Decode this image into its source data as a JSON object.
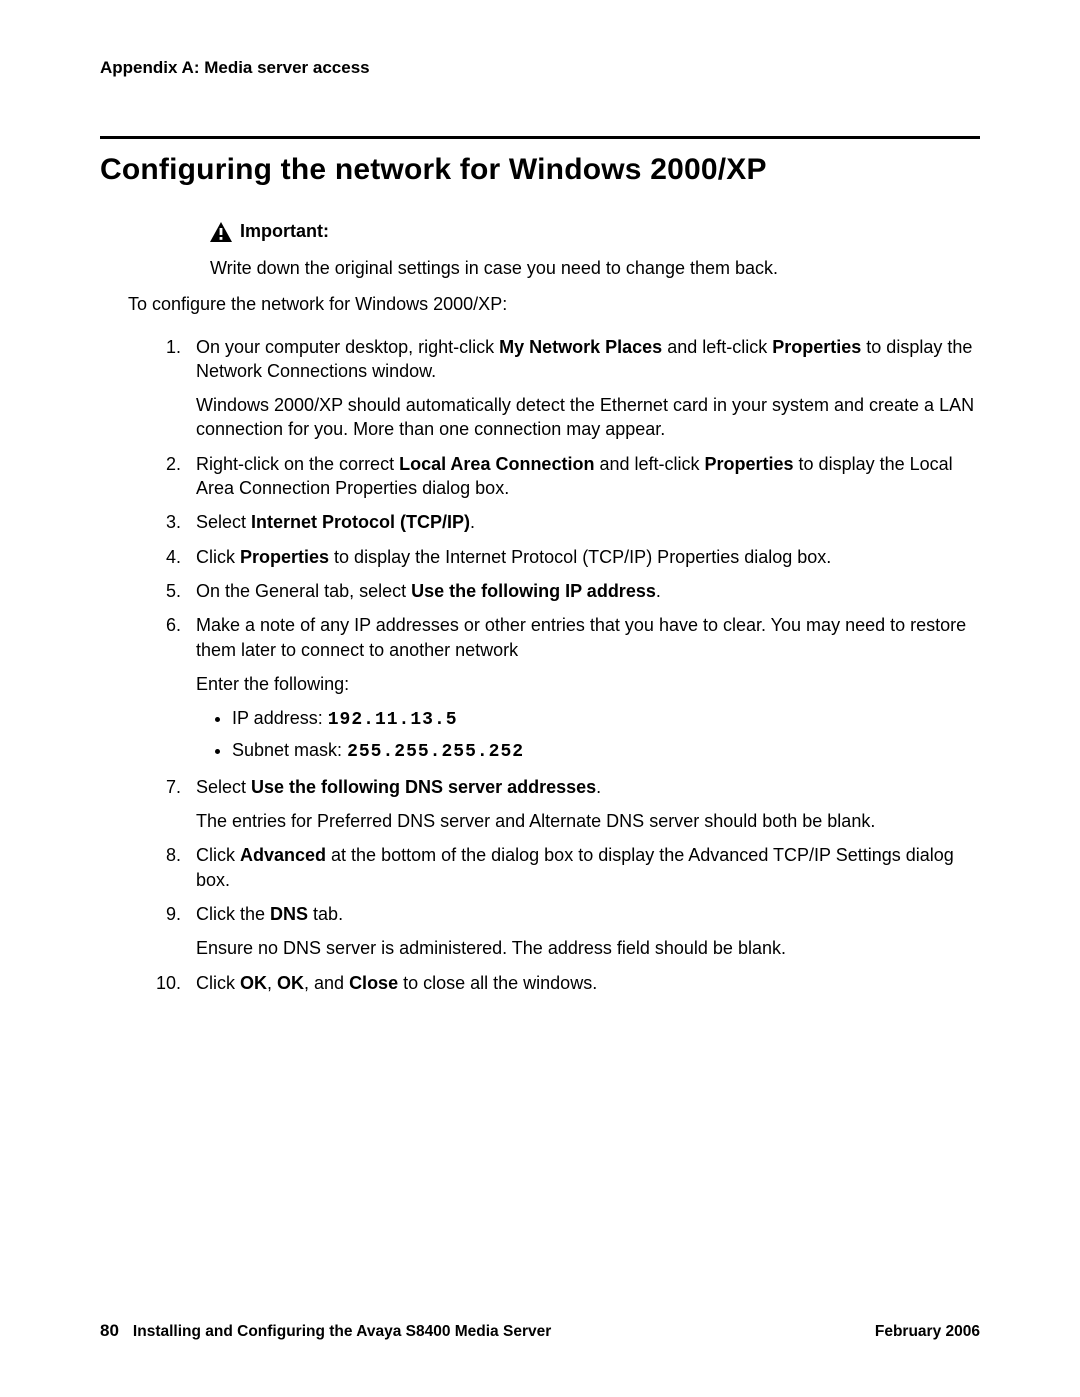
{
  "header": "Appendix A: Media server access",
  "title": "Configuring the network for Windows 2000/XP",
  "callout": {
    "label": "Important:",
    "text": "Write down the original settings in case you need to change them back."
  },
  "intro": "To configure the network for Windows 2000/XP:",
  "steps": {
    "s1": {
      "pre1": "On your computer desktop, right-click ",
      "b1": "My Network Places",
      "mid1": " and left-click ",
      "b2": "Properties",
      "post1": " to display the Network Connections window.",
      "p2": "Windows 2000/XP should automatically detect the Ethernet card in your system and create a LAN connection for you. More than one connection may appear."
    },
    "s2": {
      "pre1": "Right-click on the correct ",
      "b1": "Local Area Connection",
      "mid1": " and left-click ",
      "b2": "Properties",
      "post1": " to display the Local Area Connection Properties dialog box."
    },
    "s3": {
      "pre1": "Select ",
      "b1": "Internet Protocol (TCP/IP)",
      "post1": "."
    },
    "s4": {
      "pre1": "Click ",
      "b1": "Properties",
      "post1": " to display the Internet Protocol (TCP/IP) Properties dialog box."
    },
    "s5": {
      "pre1": "On the General tab, select ",
      "b1": "Use the following IP address",
      "post1": "."
    },
    "s6": {
      "p1": "Make a note of any IP addresses or other entries that you have to clear. You may need to restore them later to connect to another network",
      "p2": "Enter the following:",
      "ip_label": "IP address: ",
      "ip_value": "192.11.13.5",
      "mask_label": "Subnet mask: ",
      "mask_value": "255.255.255.252"
    },
    "s7": {
      "pre1": "Select ",
      "b1": "Use the following DNS server addresses",
      "post1": ".",
      "p2": "The entries for Preferred DNS server and Alternate DNS server should both be blank."
    },
    "s8": {
      "pre1": "Click ",
      "b1": "Advanced",
      "post1": " at the bottom of the dialog box to display the Advanced TCP/IP Settings dialog box."
    },
    "s9": {
      "pre1": "Click the ",
      "b1": "DNS",
      "post1": " tab.",
      "p2": "Ensure no DNS server is administered. The address field should be blank."
    },
    "s10": {
      "pre1": "Click ",
      "b1": "OK",
      "mid1": ", ",
      "b2": "OK",
      "mid2": ", and ",
      "b3": "Close",
      "post1": " to close all the windows."
    }
  },
  "footer": {
    "page": "80",
    "title": "Installing and Configuring the Avaya S8400 Media Server",
    "date": "February 2006"
  }
}
